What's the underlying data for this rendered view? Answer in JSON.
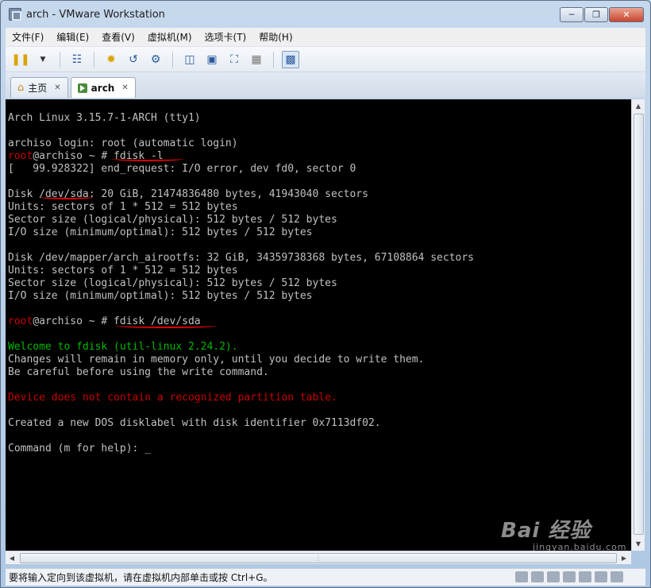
{
  "window": {
    "title": "arch - VMware Workstation",
    "minimize": "0",
    "restore": "1",
    "close": "r"
  },
  "menu": [
    "文件(F)",
    "编辑(E)",
    "查看(V)",
    "虚拟机(M)",
    "选项卡(T)",
    "帮助(H)"
  ],
  "toolbar": {
    "icons": [
      "pause-icon",
      "dropdown-icon",
      "network-icon",
      "snapshot-icon",
      "revert-snapshot-icon",
      "snapshot-manager-icon",
      "sidebar-icon",
      "console-view-icon",
      "fullscreen-icon",
      "unity-icon",
      "quick-switch-icon"
    ]
  },
  "tabs": [
    {
      "label": "主页",
      "icon": "home-icon",
      "active": false
    },
    {
      "label": "arch",
      "icon": "vm-icon",
      "active": true
    }
  ],
  "terminal": {
    "lines": [
      {
        "segments": [
          {
            "text": "Arch Linux 3.15.7-1-ARCH (tty1)",
            "color": "default"
          }
        ]
      },
      {
        "segments": []
      },
      {
        "segments": [
          {
            "text": "archiso login: root (automatic login)",
            "color": "default"
          }
        ]
      },
      {
        "segments": [
          {
            "text": "root",
            "color": "red"
          },
          {
            "text": "@archiso ~ # fdisk -l",
            "color": "default"
          }
        ]
      },
      {
        "segments": [
          {
            "text": "[   99.928322] end_request: I/O error, dev fd0, sector 0",
            "color": "default"
          }
        ]
      },
      {
        "segments": []
      },
      {
        "segments": [
          {
            "text": "Disk /dev/sda: 20 GiB, 21474836480 bytes, 41943040 sectors",
            "color": "default"
          }
        ]
      },
      {
        "segments": [
          {
            "text": "Units: sectors of 1 * 512 = 512 bytes",
            "color": "default"
          }
        ]
      },
      {
        "segments": [
          {
            "text": "Sector size (logical/physical): 512 bytes / 512 bytes",
            "color": "default"
          }
        ]
      },
      {
        "segments": [
          {
            "text": "I/O size (minimum/optimal): 512 bytes / 512 bytes",
            "color": "default"
          }
        ]
      },
      {
        "segments": []
      },
      {
        "segments": [
          {
            "text": "Disk /dev/mapper/arch_airootfs: 32 GiB, 34359738368 bytes, 67108864 sectors",
            "color": "default"
          }
        ]
      },
      {
        "segments": [
          {
            "text": "Units: sectors of 1 * 512 = 512 bytes",
            "color": "default"
          }
        ]
      },
      {
        "segments": [
          {
            "text": "Sector size (logical/physical): 512 bytes / 512 bytes",
            "color": "default"
          }
        ]
      },
      {
        "segments": [
          {
            "text": "I/O size (minimum/optimal): 512 bytes / 512 bytes",
            "color": "default"
          }
        ]
      },
      {
        "segments": []
      },
      {
        "segments": [
          {
            "text": "root",
            "color": "red"
          },
          {
            "text": "@archiso ~ # fdisk /dev/sda",
            "color": "default"
          }
        ]
      },
      {
        "segments": []
      },
      {
        "segments": [
          {
            "text": "Welcome to fdisk (util-linux 2.24.2).",
            "color": "green"
          }
        ]
      },
      {
        "segments": [
          {
            "text": "Changes will remain in memory only, until you decide to write them.",
            "color": "default"
          }
        ]
      },
      {
        "segments": [
          {
            "text": "Be careful before using the write command.",
            "color": "default"
          }
        ]
      },
      {
        "segments": []
      },
      {
        "segments": [
          {
            "text": "Device does not contain a recognized partition table.",
            "color": "red"
          }
        ]
      },
      {
        "segments": []
      },
      {
        "segments": [
          {
            "text": "Created a new DOS disklabel with disk identifier 0x7113df02.",
            "color": "default"
          }
        ]
      },
      {
        "segments": []
      },
      {
        "segments": [
          {
            "text": "Command (m for help): ",
            "color": "default"
          },
          {
            "text": "_",
            "color": "cursor"
          }
        ]
      }
    ]
  },
  "status": {
    "text": "要将输入定向到该虚拟机，请在虚拟机内部单击或按 Ctrl+G。"
  },
  "watermark": {
    "brand": "Bai 经验",
    "url": "jingyan.baidu.com"
  },
  "colors": {
    "prompt_red": "#c80000",
    "fdisk_green": "#00b800",
    "terminal_fg": "#c0c0c0",
    "terminal_bg": "#000000",
    "annotation": "#e00000"
  }
}
